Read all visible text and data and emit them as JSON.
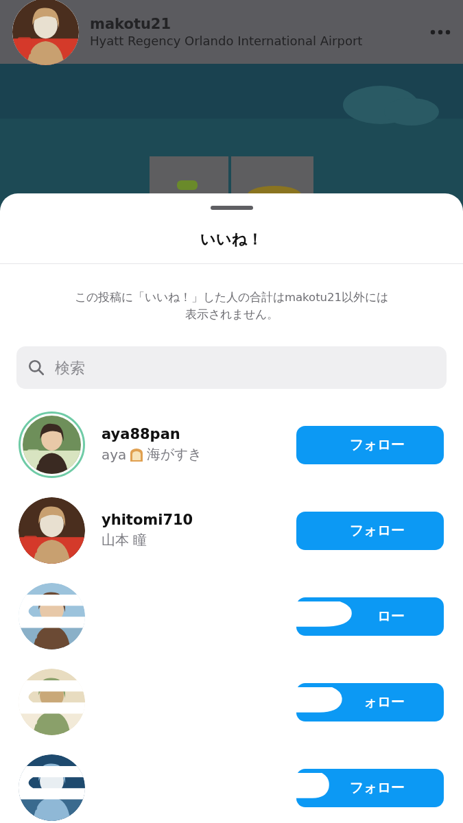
{
  "post_header": {
    "username": "makotu21",
    "location": "Hyatt Regency Orlando International Airport"
  },
  "sheet": {
    "title": "いいね！",
    "note": "この投稿に「いいね！」した人の合計はmakotu21以外には表示されません。",
    "search": {
      "placeholder": "検索"
    }
  },
  "users": [
    {
      "redacted": false,
      "username": "aya88pan",
      "name_parts": [
        "aya",
        "海がすき"
      ],
      "story_ring": true,
      "button": "フォロー"
    },
    {
      "redacted": false,
      "username": "yhitomi710",
      "name_parts": [
        "山本 瞳"
      ],
      "story_ring": false,
      "button": "フォロー"
    },
    {
      "redacted": true,
      "story_ring": false,
      "button": "ロー"
    },
    {
      "redacted": true,
      "story_ring": false,
      "button": "ォロー"
    },
    {
      "redacted": true,
      "story_ring": false,
      "button": "フォロー"
    }
  ]
}
